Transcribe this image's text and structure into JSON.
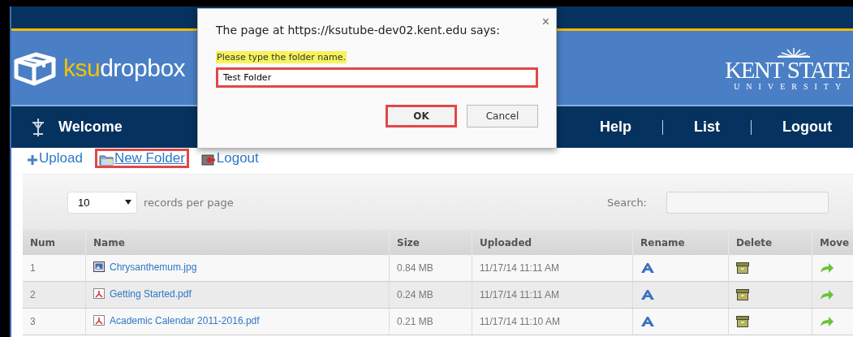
{
  "header": {
    "logo_prefix": "ksu",
    "logo_suffix": "dropbox",
    "university_name": "KENT STATE",
    "university_sub": "UNIVERSITY"
  },
  "nav": [
    {
      "label": "Welcome",
      "kind": "home"
    },
    {
      "label": "Help",
      "kind": "link"
    },
    {
      "label": "List",
      "kind": "link"
    },
    {
      "label": "Logout",
      "kind": "link"
    }
  ],
  "toolbar": [
    {
      "label": "Upload",
      "kind": "upload",
      "highlighted": false
    },
    {
      "label": "New Folder",
      "kind": "folder",
      "highlighted": true
    },
    {
      "label": "Logout",
      "kind": "logout",
      "highlighted": false
    }
  ],
  "table_controls": {
    "page_size": "10",
    "page_size_label": "records per page",
    "search_label": "Search:"
  },
  "table": {
    "columns": [
      "Num",
      "Name",
      "Size",
      "Uploaded",
      "Rename",
      "Delete",
      "Move"
    ],
    "rows": [
      {
        "num": "1",
        "name": "Chrysanthemum.jpg",
        "kind": "image",
        "size": "0.84 MB",
        "uploaded": "11/17/14 11:11 AM"
      },
      {
        "num": "2",
        "name": "Getting Started.pdf",
        "kind": "pdf",
        "size": "0.24 MB",
        "uploaded": "11/17/14 11:11 AM"
      },
      {
        "num": "3",
        "name": "Academic Calendar 2011-2016.pdf",
        "kind": "pdf",
        "size": "0.21 MB",
        "uploaded": "11/17/14 11:10 AM"
      }
    ]
  },
  "dialog": {
    "title": "The page at https://ksutube-dev02.kent.edu says:",
    "close": "×",
    "message": "Please type the folder name.",
    "input_value": "Test Folder",
    "input_highlighted": true,
    "buttons": [
      {
        "label": "OK",
        "highlighted": true
      },
      {
        "label": "Cancel",
        "highlighted": false
      }
    ]
  }
}
